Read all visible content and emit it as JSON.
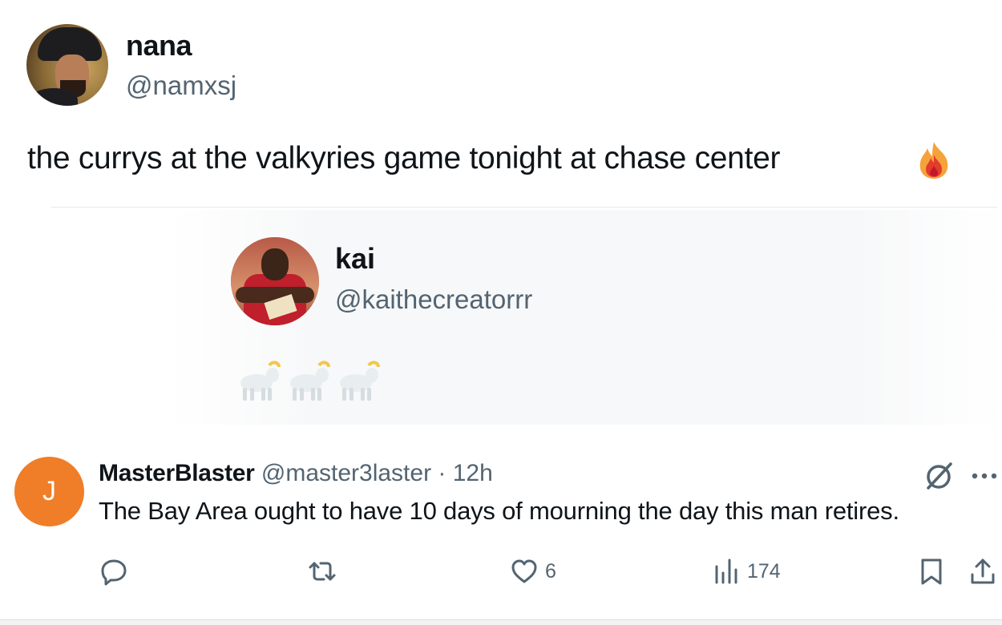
{
  "tweet": {
    "author_name": "nana",
    "author_handle": "@namxsj",
    "text": "the currys at the valkyries game tonight at chase center",
    "emoji_icon": "fire-icon"
  },
  "quote": {
    "author_name": "kai",
    "author_handle": "@kaithecreatorrr",
    "emoji_icons": [
      "goat-icon",
      "goat-icon",
      "goat-icon"
    ]
  },
  "reply": {
    "avatar_initial": "J",
    "avatar_color": "#f07d27",
    "author_name": "MasterBlaster",
    "author_handle": "@master3laster",
    "separator": "·",
    "time": "12h",
    "text": "The Bay Area ought to have 10 days of mourning the day this man retires.",
    "actions": {
      "reply_count": "",
      "retweet_count": "",
      "like_count": "6",
      "view_count": "174"
    }
  },
  "colors": {
    "primary_text": "#0f1419",
    "secondary_text": "#536471",
    "divider": "#e6e9eb"
  }
}
